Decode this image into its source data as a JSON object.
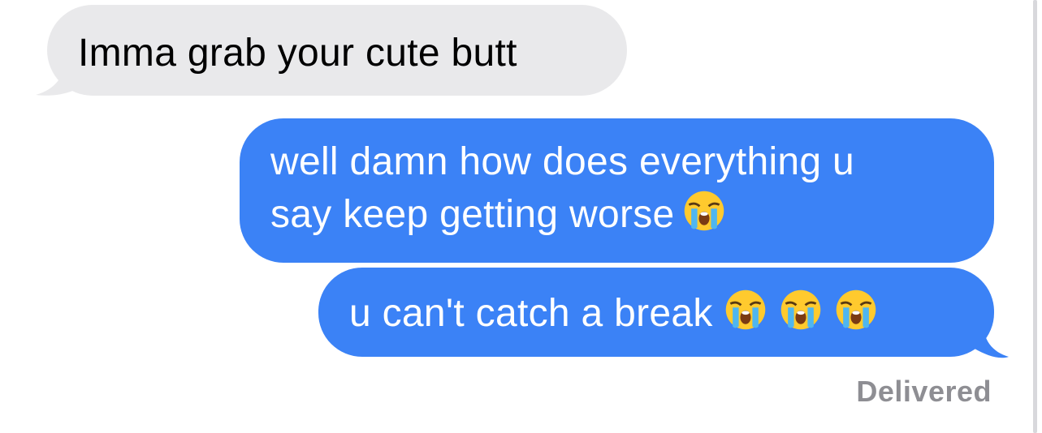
{
  "conversation": {
    "messages": [
      {
        "direction": "incoming",
        "text": "Imma grab your cute butt"
      },
      {
        "direction": "outgoing",
        "lines": [
          "well damn how does everything u",
          "say keep getting worse"
        ],
        "emoji": "loudly-crying-face"
      },
      {
        "direction": "outgoing",
        "text": "u can't catch a break",
        "emoji": [
          "loudly-crying-face",
          "loudly-crying-face",
          "loudly-crying-face"
        ]
      }
    ],
    "status": "Delivered"
  },
  "colors": {
    "incoming_bubble": "#e9e9eb",
    "outgoing_bubble": "#3b82f6",
    "status_text": "#8e8e93"
  }
}
